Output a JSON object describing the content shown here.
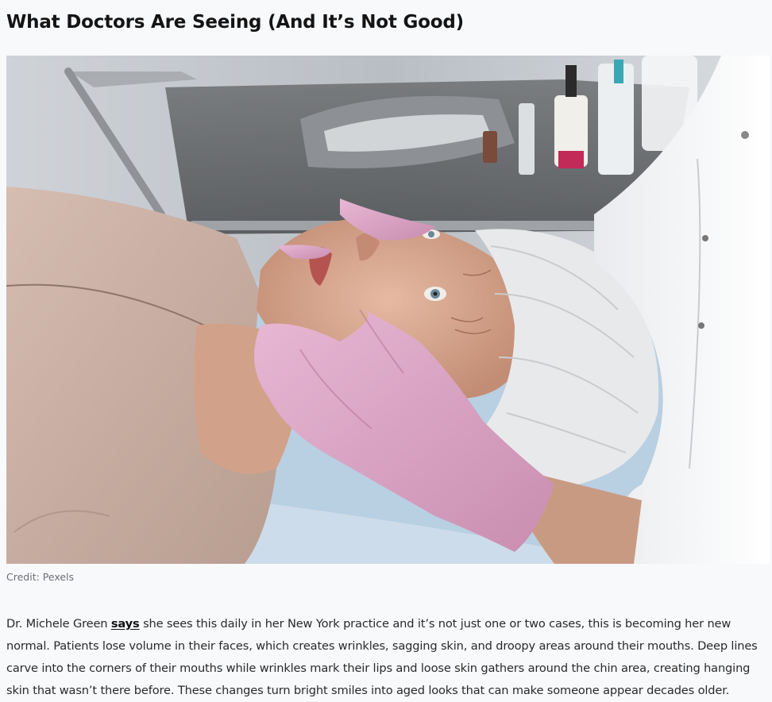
{
  "article": {
    "heading": "What Doctors Are Seeing (And It’s Not Good)",
    "image": {
      "subject": "photo-older-woman-face-held-by-pink-gloved-hands",
      "credit": "Credit: Pexels"
    },
    "paragraph": {
      "before_link": "Dr. Michele Green ",
      "link_text": "says",
      "after_link": " she sees this daily in her New York practice and it’s not just one or two cases, this is becoming her new normal. Patients lose volume in their faces, which creates wrinkles, sagging skin, and droopy areas around their mouths. Deep lines carve into the corners of their mouths while wrinkles mark their lips and loose skin gathers around the chin area, creating hanging skin that wasn’t there before. These changes turn bright smiles into aged looks that can make someone appear decades older."
    }
  }
}
